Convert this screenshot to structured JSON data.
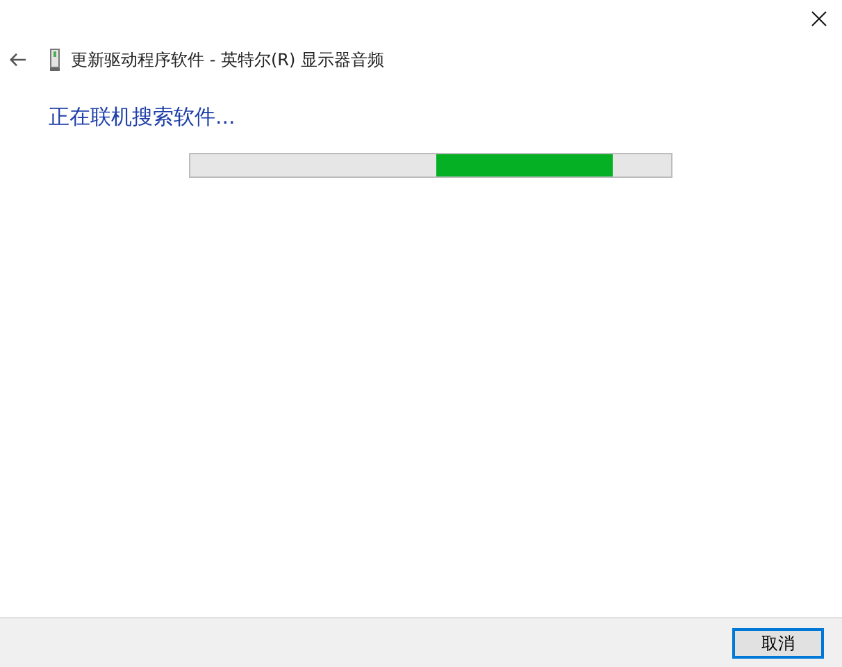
{
  "window": {
    "title": "更新驱动程序软件 - 英特尔(R) 显示器音频"
  },
  "heading": "正在联机搜索软件...",
  "progress_bar": {
    "kind": "marquee"
  },
  "buttons": [
    {
      "label": "取消",
      "default": true
    }
  ]
}
